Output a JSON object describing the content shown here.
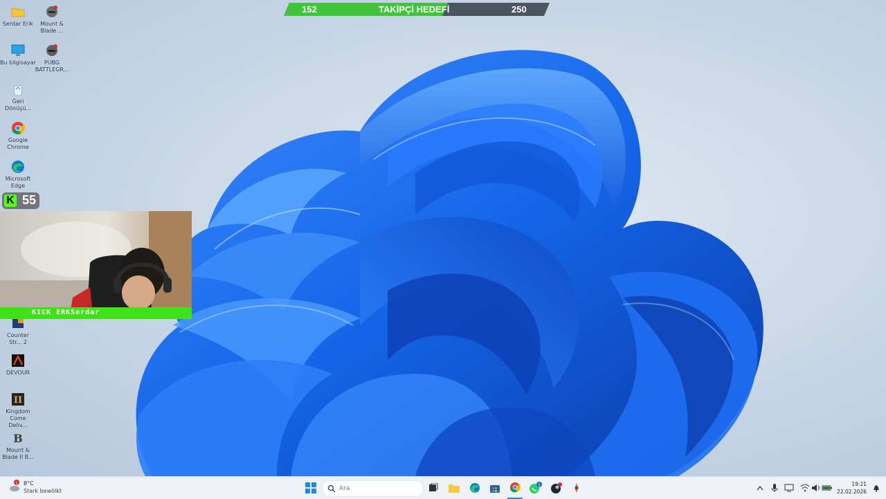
{
  "desktop": {
    "icons": [
      {
        "label": "Serdar Erik",
        "icon": "folder-icon"
      },
      {
        "label": "Mount & Blade ...",
        "icon": "game-helmet-icon"
      },
      {
        "label": "Bu bilgisayar",
        "icon": "monitor-icon"
      },
      {
        "label": "PUBG BATTLEGR...",
        "icon": "game-helmet-icon"
      },
      {
        "label": "Geri Dönüşü...",
        "icon": "recycle-bin-icon"
      },
      {
        "label": "Google Chrome",
        "icon": "chrome-icon"
      },
      {
        "label": "Microsoft Edge",
        "icon": "edge-icon"
      },
      {
        "label": "Counter Str... 2",
        "icon": "counter-strike-icon"
      },
      {
        "label": "DEVOUR",
        "icon": "devour-icon"
      },
      {
        "label": "Kingdom Come Deliv...",
        "icon": "kingdom-come-icon"
      },
      {
        "label": "Mount & Blade II B...",
        "icon": "bannerlord-icon"
      }
    ]
  },
  "overlay": {
    "goal": {
      "current": "152",
      "title": "TAKİPÇİ HEDEFİ",
      "target": "250",
      "progress_fraction": 0.608
    },
    "viewers": {
      "logo": "K",
      "count": "55"
    },
    "webcam": {
      "label": "KICK ERKSerdar"
    }
  },
  "taskbar": {
    "weather": {
      "temp": "8°C",
      "condition": "Stark bewölkt",
      "badge": "1"
    },
    "search": {
      "placeholder": "Ara"
    },
    "apps": [
      "start-icon",
      "search-icon",
      "task-view-icon",
      "file-explorer-icon",
      "edge-icon",
      "store-icon",
      "chrome-icon",
      "whatsapp-icon",
      "steam-icon",
      "game-icon"
    ],
    "whatsapp_badge": "5",
    "clock": {
      "time": "19:21",
      "date": "22.02.2026"
    }
  },
  "colors": {
    "accent_green": "#53fc18",
    "bloom_blue": "#1a6ef5",
    "goal_bg": "#4a5560"
  }
}
